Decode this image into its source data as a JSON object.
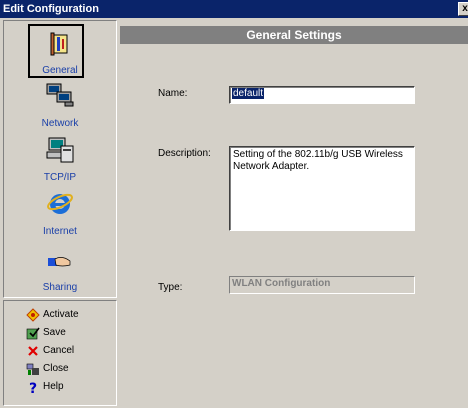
{
  "window": {
    "title": "Edit Configuration",
    "close_glyph": "x"
  },
  "nav": {
    "items": [
      {
        "label": "General",
        "icon": "general-icon"
      },
      {
        "label": "Network",
        "icon": "network-icon"
      },
      {
        "label": "TCP/IP",
        "icon": "tcpip-icon"
      },
      {
        "label": "Internet",
        "icon": "internet-icon"
      },
      {
        "label": "Sharing",
        "icon": "sharing-icon"
      }
    ],
    "selected": "General"
  },
  "actions": [
    {
      "label": "Activate",
      "icon": "activate-icon"
    },
    {
      "label": "Save",
      "icon": "save-icon"
    },
    {
      "label": "Cancel",
      "icon": "cancel-icon"
    },
    {
      "label": "Close",
      "icon": "close-icon"
    },
    {
      "label": "Help",
      "icon": "help-icon"
    }
  ],
  "main": {
    "header": "General Settings",
    "name_label": "Name:",
    "name_value": "default",
    "description_label": "Description:",
    "description_value": "Setting of the 802.11b/g USB Wireless Network Adapter.",
    "type_label": "Type:",
    "type_value": "WLAN Configuration"
  },
  "colors": {
    "titlebar": "#0a246a",
    "header": "#808080",
    "nav_text": "#1a3fa8",
    "face": "#d4d0c8"
  }
}
